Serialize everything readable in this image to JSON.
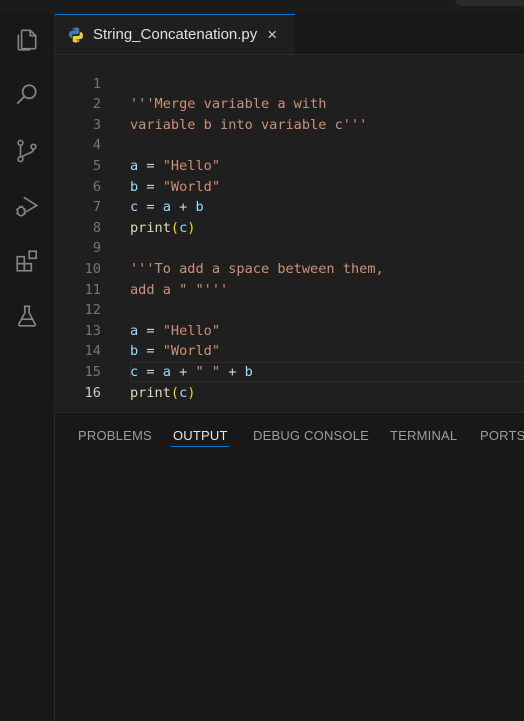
{
  "activity_bar": {
    "items": [
      {
        "icon": "explorer-icon"
      },
      {
        "icon": "search-icon"
      },
      {
        "icon": "source-control-icon"
      },
      {
        "icon": "run-debug-icon"
      },
      {
        "icon": "extensions-icon"
      },
      {
        "icon": "testing-flask-icon"
      }
    ]
  },
  "editor": {
    "tab": {
      "label": "String_Concatenation.py",
      "close": "×",
      "icon": "python-file-icon"
    },
    "active_line": "16",
    "lines": [
      {
        "n": "1"
      },
      {
        "n": "2"
      },
      {
        "n": "3"
      },
      {
        "n": "4"
      },
      {
        "n": "5"
      },
      {
        "n": "6"
      },
      {
        "n": "7"
      },
      {
        "n": "8"
      },
      {
        "n": "9"
      },
      {
        "n": "10"
      },
      {
        "n": "11"
      },
      {
        "n": "12"
      },
      {
        "n": "13"
      },
      {
        "n": "14"
      },
      {
        "n": "15"
      },
      {
        "n": "16"
      }
    ],
    "code": {
      "l1": "'''Merge variable a with",
      "l2": "variable b into variable c'''",
      "l4_var": "a",
      "eq": " = ",
      "l4_str": "\"Hello\"",
      "l5_var": "b",
      "l5_str": "\"World\"",
      "l6_var": "c",
      "l6_a": "a",
      "plus": " + ",
      "l6_b": "b",
      "print": "print",
      "lparen": "(",
      "l7_arg": "c",
      "rparen": ")",
      "l9": "'''To add a space between them,",
      "l10": "add a \" \"'''",
      "l12_var": "a",
      "l12_str": "\"Hello\"",
      "l13_var": "b",
      "l13_str": "\"World\"",
      "l14_var": "c",
      "l14_a": "a",
      "l14_space": "\" \"",
      "l14_b": "b",
      "l15_arg": "c"
    },
    "colors": {
      "string": "#ce9178",
      "variable": "#9cdcfe",
      "function": "#dcdcaa",
      "bracket": "#ffd700"
    }
  },
  "panel": {
    "tabs": [
      {
        "label": "PROBLEMS"
      },
      {
        "label": "OUTPUT"
      },
      {
        "label": "DEBUG CONSOLE"
      },
      {
        "label": "TERMINAL"
      },
      {
        "label": "PORTS"
      }
    ],
    "active_tab": "OUTPUT",
    "accent": "#0078d4"
  }
}
